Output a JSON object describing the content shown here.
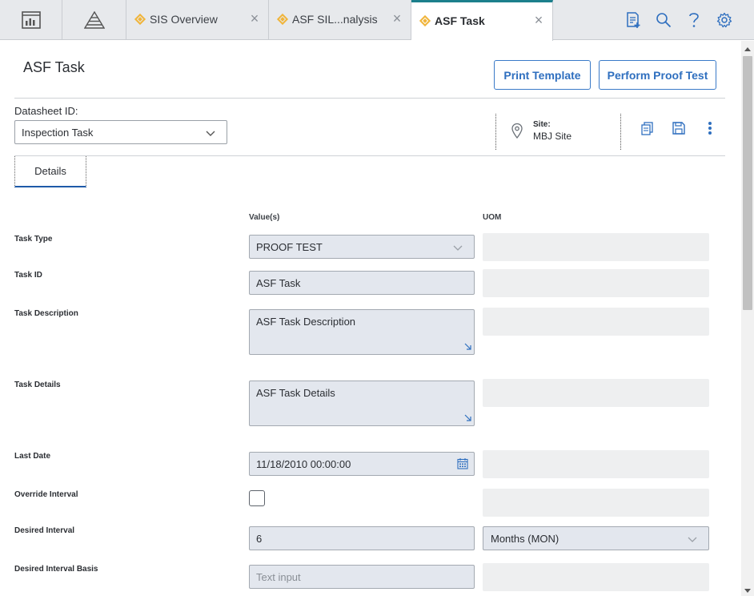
{
  "tabs": [
    {
      "label": "SIS Overview",
      "icon": "diamond-icon",
      "active": false
    },
    {
      "label": "ASF SIL...nalysis",
      "icon": "diamond-icon",
      "active": false
    },
    {
      "label": "ASF Task",
      "icon": "diamond-icon",
      "active": true
    }
  ],
  "tab_close_glyph": "×",
  "header": {
    "title": "ASF Task",
    "print_template": "Print Template",
    "perform_proof_test": "Perform Proof Test"
  },
  "datasheet": {
    "label": "Datasheet ID:",
    "value": "Inspection Task"
  },
  "site": {
    "label": "Site:",
    "value": "MBJ Site"
  },
  "detail_tab": "Details",
  "columns": {
    "values": "Value(s)",
    "uom": "UOM"
  },
  "fields": {
    "task_type": {
      "label": "Task Type",
      "value": "PROOF TEST"
    },
    "task_id": {
      "label": "Task ID",
      "value": "ASF Task"
    },
    "task_description": {
      "label": "Task Description",
      "value": "ASF Task Description"
    },
    "task_details": {
      "label": "Task Details",
      "value": "ASF Task Details"
    },
    "last_date": {
      "label": "Last Date",
      "value": "11/18/2010 00:00:00"
    },
    "override_interval": {
      "label": "Override Interval",
      "checked": false
    },
    "desired_interval": {
      "label": "Desired Interval",
      "value": "6",
      "uom": "Months (MON)"
    },
    "desired_interval_basis": {
      "label": "Desired Interval Basis",
      "placeholder": "Text input"
    }
  },
  "colors": {
    "accent": "#2f6fbf",
    "active_tab_border": "#1c7f8c",
    "tab_diamond": "#f0b43a",
    "input_bg": "#e3e7ee"
  }
}
